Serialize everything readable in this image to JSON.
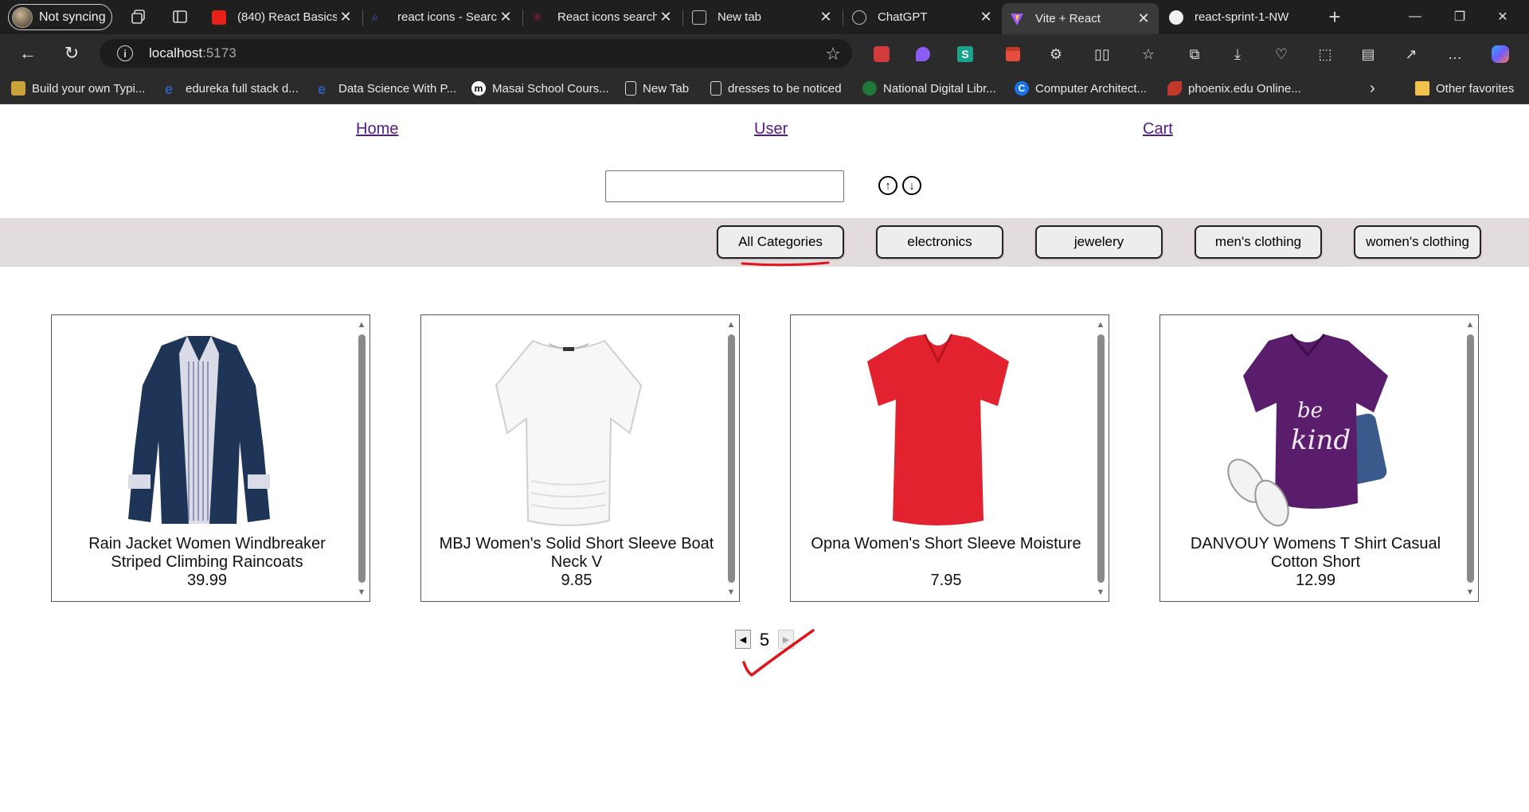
{
  "browser": {
    "profile": {
      "label": "Not syncing"
    },
    "tabs": [
      {
        "title": "(840) React Basics",
        "favicon_color": "#e62117",
        "active": false
      },
      {
        "title": "react icons - Search",
        "favicon_color": "#3a6bd1",
        "active": false
      },
      {
        "title": "React icons search",
        "favicon_color": "#c2185b",
        "active": false
      },
      {
        "title": "New tab",
        "favicon_color": "#9e9e9e",
        "active": false
      },
      {
        "title": "ChatGPT",
        "favicon_color": "#bdbdbd",
        "active": false
      },
      {
        "title": "Vite + React",
        "favicon_color": "#a259ff",
        "active": true
      },
      {
        "title": "react-sprint-1-NW",
        "favicon_color": "#f0f0f0",
        "active": false
      }
    ],
    "new_tab_icon": "plus-icon",
    "address": {
      "host": "localhost",
      "port": ":5173"
    },
    "bookmarks": [
      {
        "label": "Build your own Typi...",
        "favicon_color": "#c9a23a"
      },
      {
        "label": "edureka full stack d...",
        "favicon_color": "#2f5fb3"
      },
      {
        "label": "Data Science With P...",
        "favicon_color": "#2f5fb3"
      },
      {
        "label": "Masai School Cours...",
        "favicon_color": "#ffffff"
      },
      {
        "label": "New Tab",
        "favicon_color": "#ffffff"
      },
      {
        "label": "dresses to be noticed",
        "favicon_color": "#ffffff"
      },
      {
        "label": "National Digital Libr...",
        "favicon_color": "#1f7a3a"
      },
      {
        "label": "Computer Architect...",
        "favicon_color": "#1a73e8"
      },
      {
        "label": "phoenix.edu Online...",
        "favicon_color": "#c0392b"
      }
    ],
    "other_favorites": "Other favorites"
  },
  "nav": {
    "home": "Home",
    "user": "User",
    "cart": "Cart"
  },
  "search": {
    "value": "",
    "placeholder": ""
  },
  "sort": {
    "asc_icon": "arrow-up-circle-icon",
    "desc_icon": "arrow-down-circle-icon"
  },
  "categories": [
    "All Categories",
    "electronics",
    "jewelery",
    "men's clothing",
    "women's clothing"
  ],
  "selected_category": "All Categories",
  "products": [
    {
      "title": "Rain Jacket Women Windbreaker Striped Climbing Raincoats",
      "price": "39.99"
    },
    {
      "title": "MBJ Women's Solid Short Sleeve Boat Neck V",
      "price": "9.85"
    },
    {
      "title": "Opna Women's Short Sleeve Moisture",
      "price": "7.95"
    },
    {
      "title": "DANVOUY Womens T Shirt Casual Cotton Short",
      "price": "12.99"
    }
  ],
  "pagination": {
    "page": "5",
    "prev_icon": "caret-left-icon",
    "next_icon": "caret-right-icon"
  },
  "annotation_colors": {
    "ink": "#e0141b"
  }
}
